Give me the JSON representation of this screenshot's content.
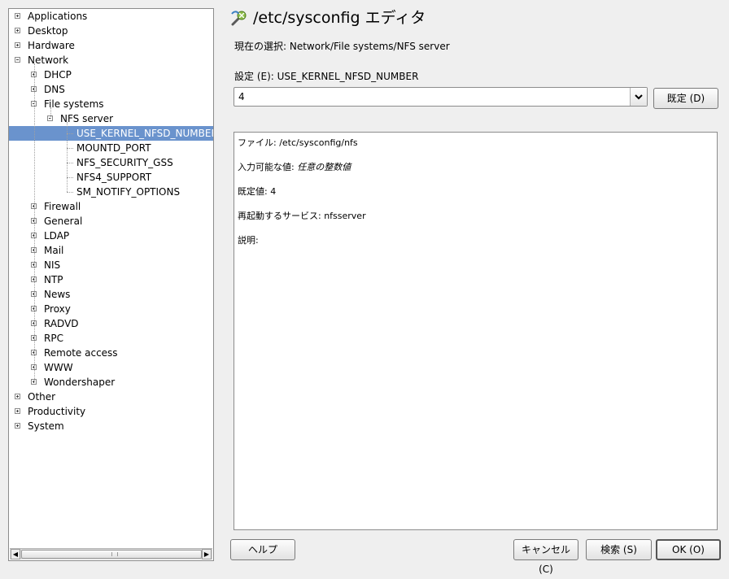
{
  "window": {
    "title": "/etc/sysconfig エディタ",
    "current_selection": "現在の選択: Network/File systems/NFS server"
  },
  "tree": {
    "items": [
      {
        "label": "Applications",
        "level": 0,
        "expander": "plus"
      },
      {
        "label": "Desktop",
        "level": 0,
        "expander": "plus"
      },
      {
        "label": "Hardware",
        "level": 0,
        "expander": "plus"
      },
      {
        "label": "Network",
        "level": 0,
        "expander": "minus"
      },
      {
        "label": "DHCP",
        "level": 1,
        "expander": "plus"
      },
      {
        "label": "DNS",
        "level": 1,
        "expander": "plus"
      },
      {
        "label": "File systems",
        "level": 1,
        "expander": "minus"
      },
      {
        "label": "NFS server",
        "level": 2,
        "expander": "minus"
      },
      {
        "label": "USE_KERNEL_NFSD_NUMBER",
        "level": 3,
        "expander": "none",
        "selected": true
      },
      {
        "label": "MOUNTD_PORT",
        "level": 3,
        "expander": "none"
      },
      {
        "label": "NFS_SECURITY_GSS",
        "level": 3,
        "expander": "none"
      },
      {
        "label": "NFS4_SUPPORT",
        "level": 3,
        "expander": "none"
      },
      {
        "label": "SM_NOTIFY_OPTIONS",
        "level": 3,
        "expander": "none"
      },
      {
        "label": "Firewall",
        "level": 1,
        "expander": "plus"
      },
      {
        "label": "General",
        "level": 1,
        "expander": "plus"
      },
      {
        "label": "LDAP",
        "level": 1,
        "expander": "plus"
      },
      {
        "label": "Mail",
        "level": 1,
        "expander": "plus"
      },
      {
        "label": "NIS",
        "level": 1,
        "expander": "plus"
      },
      {
        "label": "NTP",
        "level": 1,
        "expander": "plus"
      },
      {
        "label": "News",
        "level": 1,
        "expander": "plus"
      },
      {
        "label": "Proxy",
        "level": 1,
        "expander": "plus"
      },
      {
        "label": "RADVD",
        "level": 1,
        "expander": "plus"
      },
      {
        "label": "RPC",
        "level": 1,
        "expander": "plus"
      },
      {
        "label": "Remote access",
        "level": 1,
        "expander": "plus"
      },
      {
        "label": "WWW",
        "level": 1,
        "expander": "plus"
      },
      {
        "label": "Wondershaper",
        "level": 1,
        "expander": "plus"
      },
      {
        "label": "Other",
        "level": 0,
        "expander": "plus"
      },
      {
        "label": "Productivity",
        "level": 0,
        "expander": "plus"
      },
      {
        "label": "System",
        "level": 0,
        "expander": "plus"
      }
    ]
  },
  "setting": {
    "label": "設定 (E): USE_KERNEL_NFSD_NUMBER",
    "value": "4",
    "default_button": "既定 (D)"
  },
  "info": {
    "file": "ファイル: /etc/sysconfig/nfs",
    "possible_values_label": "入力可能な値: ",
    "possible_values": "任意の整数値",
    "default_value": "既定値: 4",
    "restart_service": "再起動するサービス: nfsserver",
    "description": "説明:"
  },
  "buttons": {
    "help": "ヘルプ",
    "cancel": "キャンセル (C)",
    "search": "検索 (S)",
    "ok": "OK (O)"
  },
  "icons": {
    "title_icon": "yast-sysconfig-icon",
    "scroll_left": "arrow-left-icon",
    "scroll_right": "arrow-right-icon",
    "combo_arrow": "chevron-down-icon"
  },
  "colors": {
    "selection": "#6a93cd",
    "background": "#efefef"
  }
}
